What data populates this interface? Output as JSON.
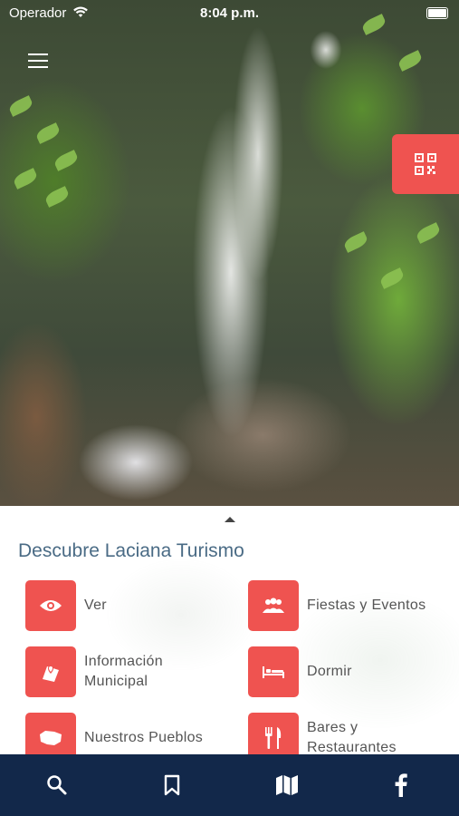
{
  "status_bar": {
    "carrier": "Operador",
    "time": "8:04 p.m."
  },
  "panel": {
    "title": "Descubre Laciana Turismo",
    "items": [
      {
        "label": "Ver",
        "icon": "eye-icon"
      },
      {
        "label": "Fiestas y Eventos",
        "icon": "people-icon"
      },
      {
        "label": "Información\nMunicipal",
        "icon": "map-pin-icon"
      },
      {
        "label": "Dormir",
        "icon": "bed-icon"
      },
      {
        "label": "Nuestros Pueblos",
        "icon": "region-map-icon"
      },
      {
        "label": "Bares y\nRestaurantes",
        "icon": "fork-knife-icon"
      }
    ]
  },
  "tab_bar": [
    "search-icon",
    "bookmark-icon",
    "map-icon",
    "facebook-icon"
  ],
  "colors": {
    "accent": "#ef5350",
    "tab_bar": "#12284a",
    "title": "#4a6b85"
  }
}
